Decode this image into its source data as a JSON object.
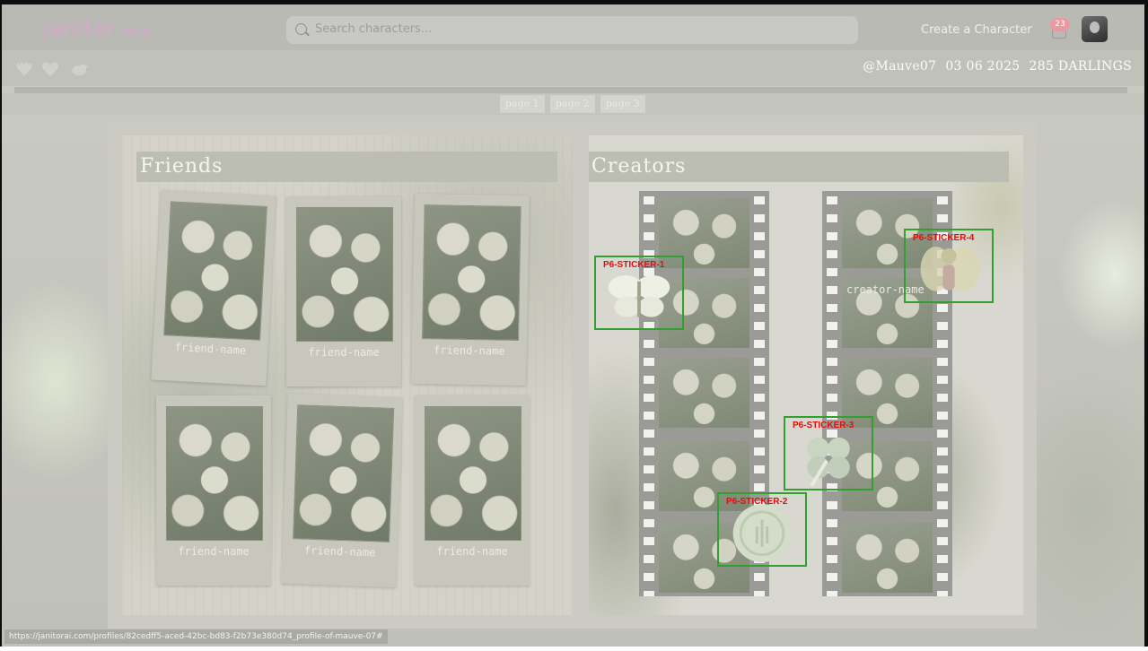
{
  "topbar": {
    "logo": "janitor",
    "logo_badge": "beta",
    "search_placeholder": "Search characters...",
    "create_label": "Create a Character",
    "notification_count": "23"
  },
  "profile": {
    "username": "@Mauve07",
    "date": "03 06 2025",
    "darlings": "285 DARLINGS"
  },
  "pager": [
    "page 1",
    "page 2",
    "page 3"
  ],
  "friends": {
    "title": "Friends",
    "cards": [
      "friend-name",
      "friend-name",
      "friend-name",
      "friend-name",
      "friend-name",
      "friend-name"
    ]
  },
  "creators": {
    "title": "Creators",
    "creator_label": "creator-name"
  },
  "stickers": [
    "P6-STICKER-1",
    "P6-STICKER-2",
    "P6-STICKER-3",
    "P6-STICKER-4"
  ],
  "status_url": "https://janitorai.com/profiles/82cedff5-aced-42bc-bd83-f2b73e380d74_profile-of-mauve-07#",
  "colors": {
    "accent": "#d8a8d0",
    "sticker_border": "#31a02f",
    "sticker_label": "#e01010",
    "notif": "#e79a9f"
  }
}
